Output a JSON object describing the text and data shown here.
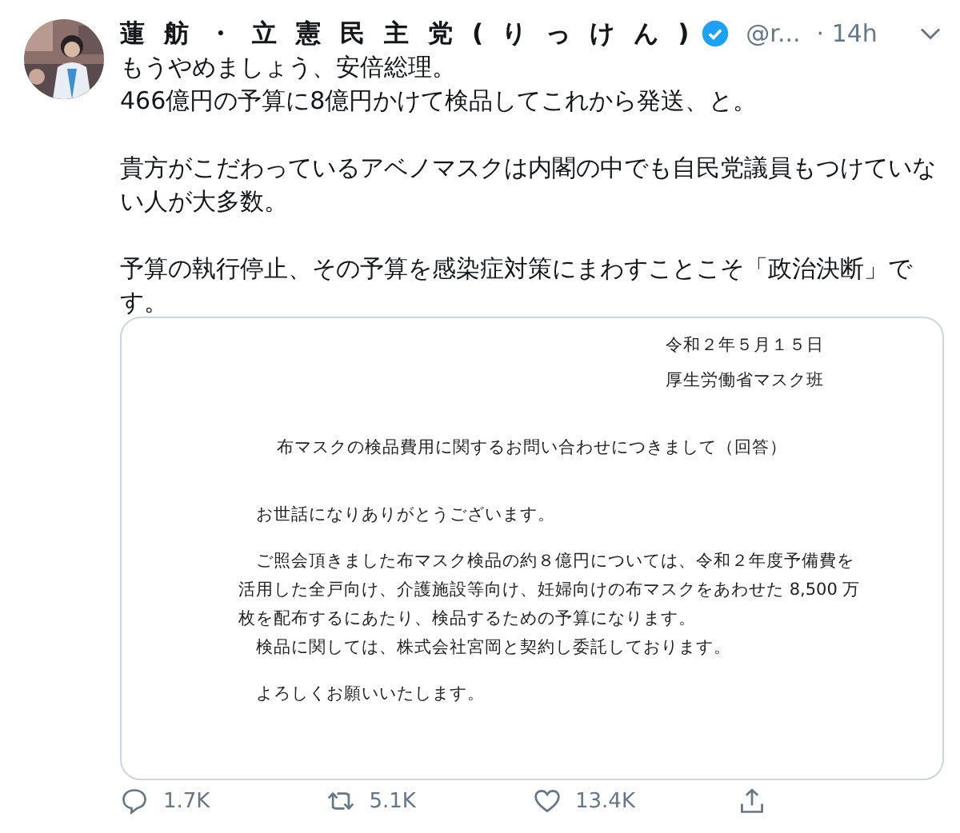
{
  "tweet": {
    "author": {
      "name": "蓮舫・立憲民主党(りっけん)",
      "verified": true,
      "handle": "@r...",
      "time": "· 14h"
    },
    "text": [
      "もうやめましょう、安倍総理。\n466億円の予算に8億円かけて検品してこれから発送、と。",
      "貴方がこだわっているアベノマスクは内閣の中でも自民党議員もつけていない人が大多数。",
      "予算の執行停止、その予算を感染症対策にまわすことこそ「政治決断」です。"
    ],
    "document": {
      "header": [
        "令和２年５月１５日",
        "厚生労働省マスク班"
      ],
      "title": "布マスクの検品費用に関するお問い合わせにつきまして（回答）",
      "sections": [
        {
          "paragraphs": [
            {
              "lines": [
                "お世話になりありがとうございます。"
              ]
            }
          ]
        },
        {
          "paragraphs": [
            {
              "lines": [
                "ご照会頂きました布マスク検品の約８億円については、令和２年度予備費を",
                "活用した全戸向け、介護施設等向け、妊婦向けの布マスクをあわせた 8,500 万",
                "枚を配布するにあたり、検品するための予算になります。"
              ]
            },
            {
              "lines": [
                "検品に関しては、株式会社宮岡と契約し委託しております。"
              ]
            }
          ]
        },
        {
          "paragraphs": [
            {
              "lines": [
                "よろしくお願いいたします。"
              ]
            }
          ]
        }
      ]
    },
    "actions": [
      {
        "kind": "reply",
        "count": "1.7K"
      },
      {
        "kind": "retweet",
        "count": "5.1K"
      },
      {
        "kind": "like",
        "count": "13.4K"
      },
      {
        "kind": "share"
      }
    ]
  }
}
